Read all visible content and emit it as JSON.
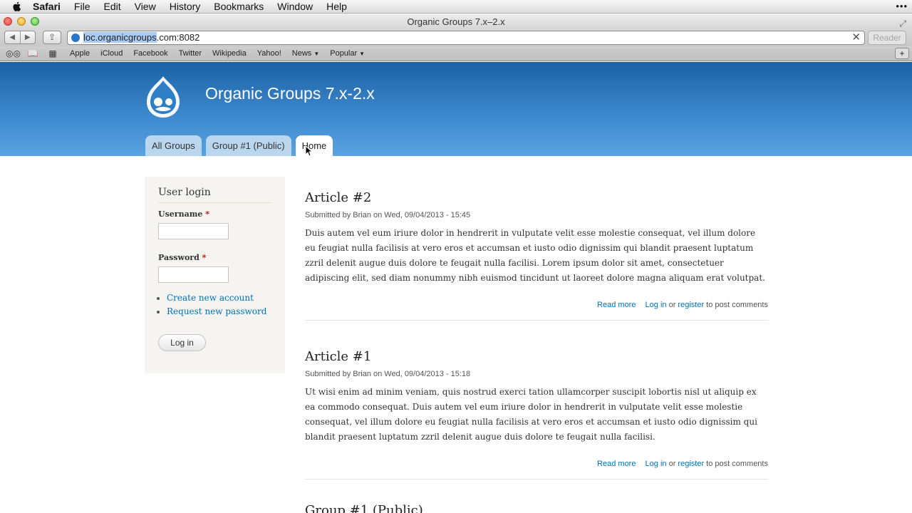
{
  "menubar": {
    "app_name": "Safari",
    "items": [
      "File",
      "Edit",
      "View",
      "History",
      "Bookmarks",
      "Window",
      "Help"
    ]
  },
  "window": {
    "title": "Organic Groups 7.x–2.x"
  },
  "toolbar": {
    "url_selected": "loc.organicgroups",
    "url_rest": ".com:8082",
    "reader_label": "Reader"
  },
  "bookmarks": [
    "Apple",
    "iCloud",
    "Facebook",
    "Twitter",
    "Wikipedia",
    "Yahoo!",
    "News",
    "Popular"
  ],
  "site": {
    "name": "Organic Groups 7.x-2.x",
    "tabs": [
      "All Groups",
      "Group #1 (Public)",
      "Home"
    ],
    "active_tab": "Home",
    "brand_color": "#2c76bd"
  },
  "login": {
    "title": "User login",
    "username_label": "Username",
    "password_label": "Password",
    "required_mark": "*",
    "links": [
      "Create new account",
      "Request new password"
    ],
    "submit_label": "Log in"
  },
  "articles": [
    {
      "title": "Article #2",
      "submitted": "Submitted by Brian on Wed, 09/04/2013 - 15:45",
      "body": "Duis autem vel eum iriure dolor in hendrerit in vulputate velit esse molestie consequat, vel illum dolore eu feugiat nulla facilisis at vero eros et accumsan et iusto odio dignissim qui blandit praesent luptatum zzril delenit augue duis dolore te feugait nulla facilisi. Lorem ipsum dolor sit amet, consectetuer adipiscing elit, sed diam nonummy nibh euismod tincidunt ut laoreet dolore magna aliquam erat volutpat.",
      "read_more": "Read more",
      "log_in": "Log in",
      "or": "or",
      "register": "register",
      "post_comments": "to post comments"
    },
    {
      "title": "Article #1",
      "submitted": "Submitted by Brian on Wed, 09/04/2013 - 15:18",
      "body": "Ut wisi enim ad minim veniam, quis nostrud exerci tation ullamcorper suscipit lobortis nisl ut aliquip ex ea commodo consequat. Duis autem vel eum iriure dolor in hendrerit in vulputate velit esse molestie consequat, vel illum dolore eu feugiat nulla facilisis at vero eros et accumsan et iusto odio dignissim qui blandit praesent luptatum zzril delenit augue duis dolore te feugait nulla facilisi.",
      "read_more": "Read more",
      "log_in": "Log in",
      "or": "or",
      "register": "register",
      "post_comments": "to post comments"
    }
  ],
  "peek_title": "Group #1 (Public)"
}
